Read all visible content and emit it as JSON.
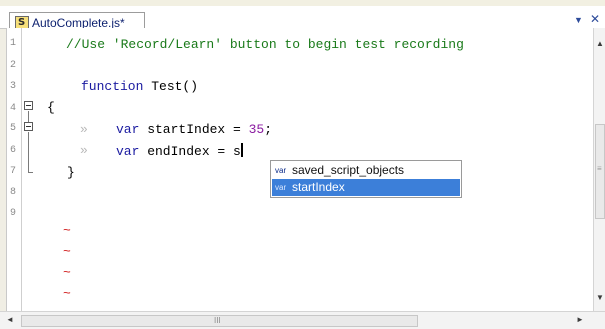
{
  "tab": {
    "title": "AutoComplete.js*",
    "dropdown_glyph": "▼",
    "close_glyph": "✕",
    "icon": "script-file-icon",
    "icon_glyph": "S"
  },
  "editor": {
    "line_numbers": [
      "1",
      "2",
      "3",
      "4",
      "5",
      "6",
      "7",
      "8",
      "9"
    ],
    "lines": [
      {
        "comment": "//Use 'Record/Learn' button to begin test recording"
      },
      {},
      {
        "keyword": "function",
        "rest": " Test()"
      },
      {
        "brace": "{"
      },
      {
        "tab_marker": "»",
        "keyword": "var",
        "ident": " startIndex = ",
        "number": "35",
        "end": ";"
      },
      {
        "tab_marker": "»",
        "keyword": "var",
        "ident": " endIndex = s"
      },
      {
        "brace": "}"
      },
      {},
      {}
    ],
    "empty_line_markers": [
      "~",
      "~",
      "~",
      "~"
    ]
  },
  "autocomplete": {
    "items": [
      {
        "tag": "var",
        "label": "saved_script_objects",
        "selected": false
      },
      {
        "tag": "var",
        "label": "startIndex",
        "selected": true
      }
    ]
  },
  "scrollbars": {
    "up": "▲",
    "down": "▼",
    "left": "◄",
    "right": "►",
    "grip_v": "≡",
    "grip_h": "III"
  },
  "colors": {
    "comment": "#1a7a1a",
    "keyword": "#1a1aa0",
    "number": "#8a1aa0",
    "selection": "#3c7fd9",
    "squiggle": "#d01818"
  }
}
